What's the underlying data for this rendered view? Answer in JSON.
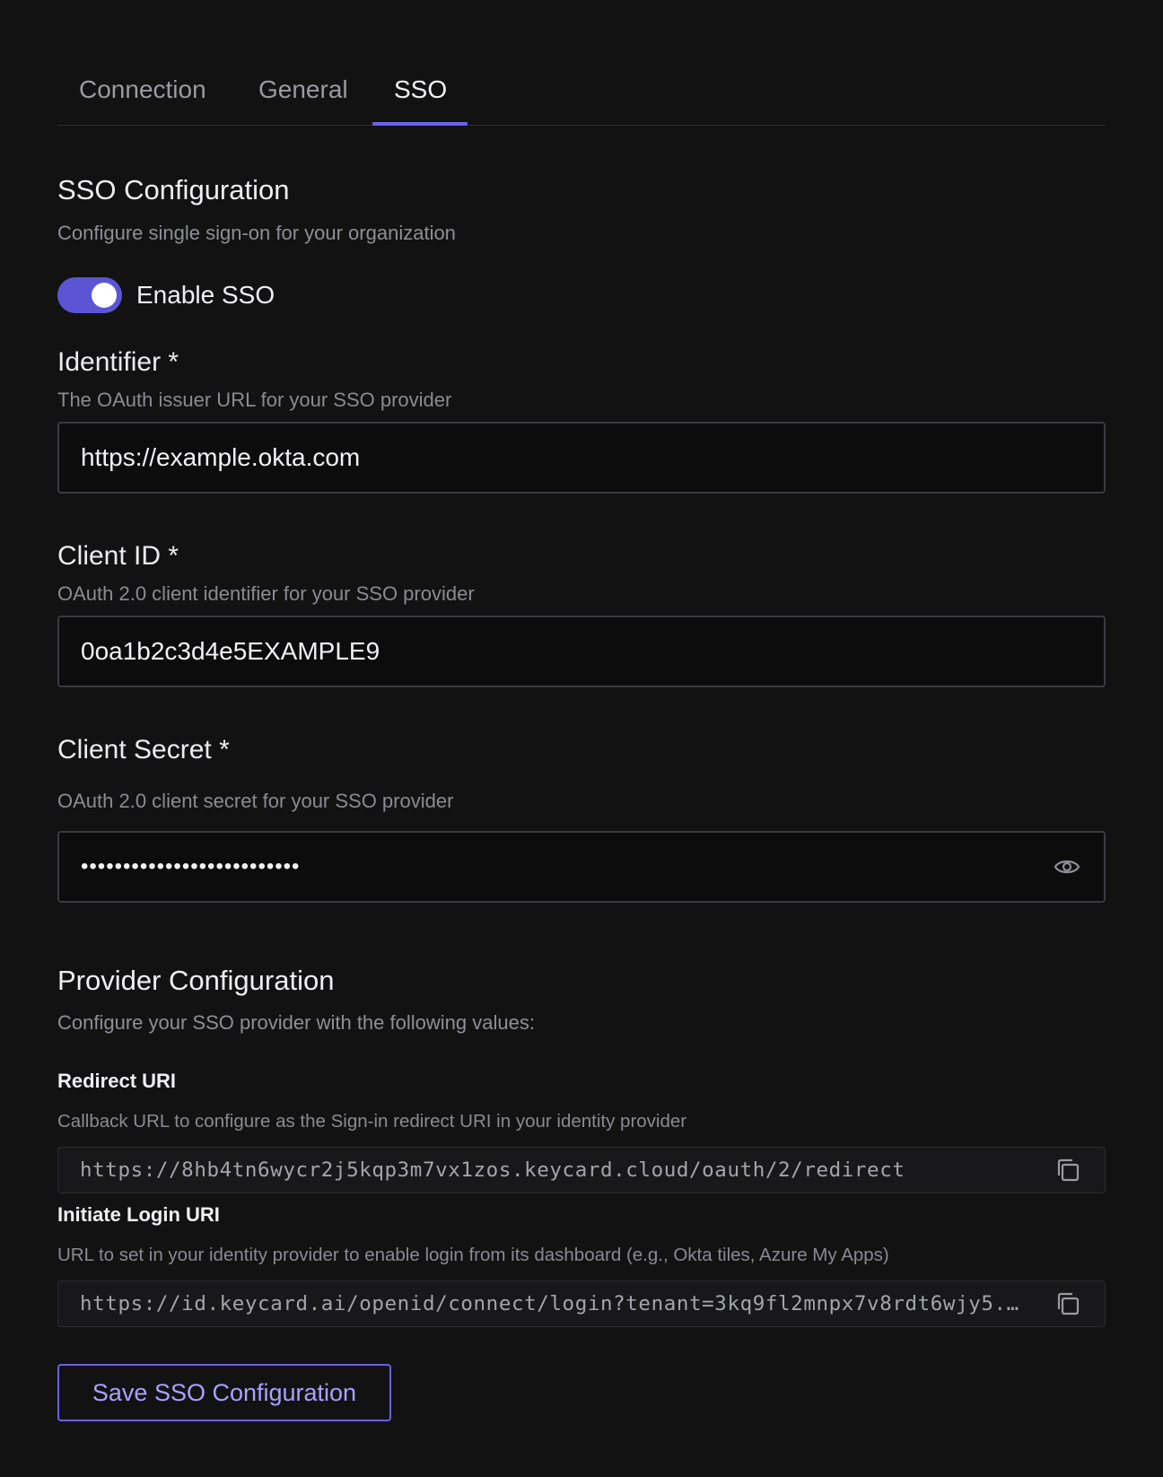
{
  "tabs": [
    {
      "label": "Connection",
      "active": false
    },
    {
      "label": "General",
      "active": false
    },
    {
      "label": "SSO",
      "active": true
    }
  ],
  "sso": {
    "title": "SSO Configuration",
    "subtitle": "Configure single sign-on for your organization",
    "toggle_label": "Enable SSO",
    "toggle_on": true
  },
  "identifier": {
    "label": "Identifier *",
    "description": "The OAuth issuer URL for your SSO provider",
    "value": "https://example.okta.com"
  },
  "client_id": {
    "label": "Client ID *",
    "description": "OAuth 2.0 client identifier for your SSO provider",
    "value": "0oa1b2c3d4e5EXAMPLE9"
  },
  "client_secret": {
    "label": "Client Secret *",
    "description": "OAuth 2.0 client secret for your SSO provider",
    "masked_value": "••••••••••••••••••••••••••",
    "icon": "eye-icon"
  },
  "provider": {
    "title": "Provider Configuration",
    "subtitle": "Configure your SSO provider with the following values:",
    "redirect": {
      "label": "Redirect URI",
      "description": "Callback URL to configure as the Sign-in redirect URI in your identity provider",
      "value": "https://8hb4tn6wycr2j5kqp3m7vx1zos.keycard.cloud/oauth/2/redirect"
    },
    "login": {
      "label": "Initiate Login URI",
      "description": "URL to set in your identity provider to enable login from its dashboard (e.g., Okta tiles, Azure My Apps)",
      "value": "https://id.keycard.ai/openid/connect/login?tenant=3kq9fl2mnpx7v8rdt6wjy5..."
    }
  },
  "save_label": "Save SSO Configuration",
  "colors": {
    "accent": "#5b55d6",
    "background": "#121213",
    "button_text": "#a7a2ff"
  }
}
